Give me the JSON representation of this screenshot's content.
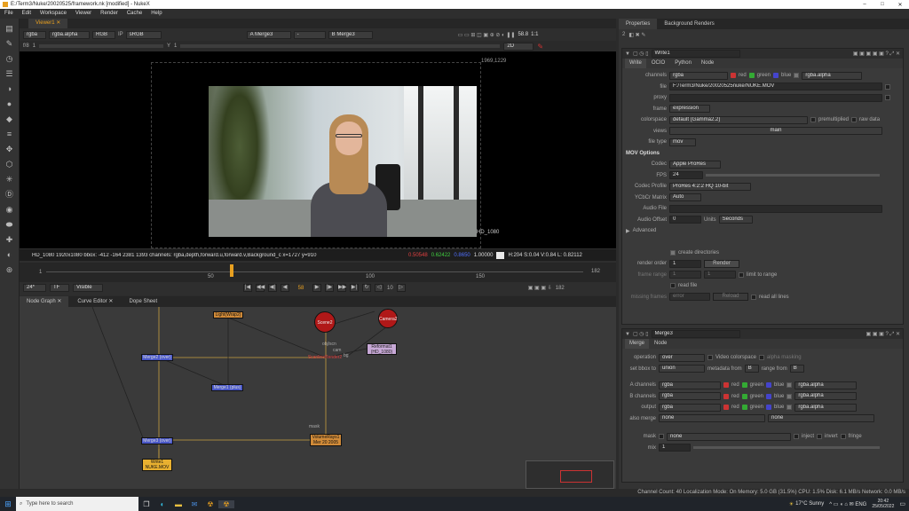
{
  "window": {
    "title": "E:/Term3/Nuke/20020525/framework.nk [modified] - NukeX",
    "controls": [
      "–",
      "□",
      "✕"
    ]
  },
  "menu": [
    "File",
    "Edit",
    "Workspace",
    "Viewer",
    "Render",
    "Cache",
    "Help"
  ],
  "viewer": {
    "tab": "Viewer1",
    "toolbar": {
      "channels": "rgba",
      "layer": "rgba.alpha",
      "color": "RGB",
      "ip": "IP",
      "lut": "sRGB",
      "input_a": "A  Merge3",
      "a_op": "-",
      "input_b": "B  Merge3",
      "fstop": "f/8",
      "f_val": "1",
      "y_label": "Y",
      "y_val": "1",
      "zoom_val": "58.8",
      "ratio": "1:1",
      "mode": "2D"
    },
    "format_label": "HD_1080",
    "corner_coords": "1969,1229",
    "info": {
      "left": "HD_1080 1920x1080  bbox: -412 -164 2381 1393 channels: rgba,depth,forward.u,forward.v,Background_c  x=1727 y=910",
      "r": "0.50548",
      "g": "0.62422",
      "b": "0.8650",
      "a": "1.00000",
      "hsvl": "H:204 S:0.04 V:0.84  L: 0.82112"
    }
  },
  "timeline": {
    "start": "1",
    "marks": [
      "1",
      "50",
      "100",
      "150"
    ],
    "end": "182",
    "current": "58",
    "fps": "24*",
    "tf": "TF",
    "visible": "Visible",
    "step": "10"
  },
  "graph": {
    "tabs": [
      "Node Graph",
      "Curve Editor",
      "Dope Sheet"
    ],
    "nodes": {
      "light": "Light(Wrap2)",
      "scene": "Scene2",
      "camera": "Camera2",
      "render": "ScanlineRender2",
      "reformat": "Reformat1\n(HD_1080)",
      "merge2": "Merge2 (over)",
      "merge1": "Merge1 (plus)",
      "merge3": "Merge3 (over)",
      "volume": "VolumeRays1\nMer 20 2005",
      "write": "Write1\nNUKE.MOV",
      "label_obj": "obj/scn",
      "label_cam": "cam",
      "label_bg": "bg",
      "label_mask": "mask"
    }
  },
  "properties": {
    "tabs": [
      "Properties",
      "Background Renders"
    ],
    "count": "2",
    "write": {
      "name": "Write1",
      "tabs": [
        "Write",
        "OCIO",
        "Python",
        "Node"
      ],
      "channels_label": "channels",
      "channels": "rgba",
      "red": "red",
      "green": "green",
      "blue": "blue",
      "alpha": "rgba.alpha",
      "file_label": "file",
      "file": "F:/Term3/Nuke/20020525nuke/NUKE.MOV",
      "proxy_label": "proxy",
      "frame_label": "frame",
      "frame": "expression",
      "colorspace_label": "colorspace",
      "colorspace": "default (Gamma2.2)",
      "premultiplied": "premultiplied",
      "raw": "raw data",
      "views_label": "views",
      "views": "main",
      "filetype_label": "file type",
      "filetype": "mov",
      "section": "MOV Options",
      "codec_label": "Codec",
      "codec": "Apple ProRes",
      "fps_label": "FPS",
      "fps": "24",
      "profile_label": "Codec Profile",
      "profile": "ProRes 4:2:2 HQ 10-bit",
      "ycbcr_label": "YCbCr Matrix",
      "ycbcr": "Auto",
      "audio_label": "Audio File",
      "offset_label": "Audio Offset",
      "offset": "0",
      "units_label": "Units",
      "units": "Seconds",
      "advanced": "Advanced",
      "create_dirs": "create directories",
      "render_order_label": "render order",
      "render_order": "1",
      "render_btn": "Render",
      "frame_range_label": "frame range",
      "fr_start": "1",
      "fr_end": "1",
      "limit": "limit to range",
      "read_file": "read file",
      "missing_label": "missing frames",
      "missing": "error",
      "reload": "Reload",
      "read_all": "read all lines"
    },
    "merge": {
      "name": "Merge3",
      "tabs": [
        "Merge",
        "Node"
      ],
      "operation_label": "operation",
      "operation": "over",
      "video_cs": "Video colorspace",
      "alpha_masking": "alpha masking",
      "bbox_label": "set bbox to",
      "bbox": "union",
      "metadata_label": "metadata from",
      "metadata": "B",
      "range_label": "range from",
      "range": "B",
      "a_label": "A channels",
      "a": "rgba",
      "b_label": "B channels",
      "b": "rgba",
      "out_label": "output",
      "out": "rgba",
      "red": "red",
      "green": "green",
      "blue": "blue",
      "alpha": "rgba.alpha",
      "also_label": "also merge",
      "also": "none",
      "also2": "none",
      "mask_label": "mask",
      "mask": "none",
      "inject": "inject",
      "invert": "invert",
      "fringe": "fringe",
      "mix_label": "mix",
      "mix": "1"
    }
  },
  "status": "Channel Count: 40  Localization Mode: On  Memory: 5.0 GB (31.5%)  CPU: 1.5%  Disk: 6.1 MB/s  Network: 0.0 MB/s",
  "taskbar": {
    "search": "Type here to search",
    "weather": "17°C  Sunny",
    "time": "20:42",
    "date": "25/05/2022"
  },
  "colors": {
    "accent": "#e8a020",
    "red_node": "#b01818",
    "blue_node": "#4a58c8",
    "orange_node": "#d08a38"
  }
}
